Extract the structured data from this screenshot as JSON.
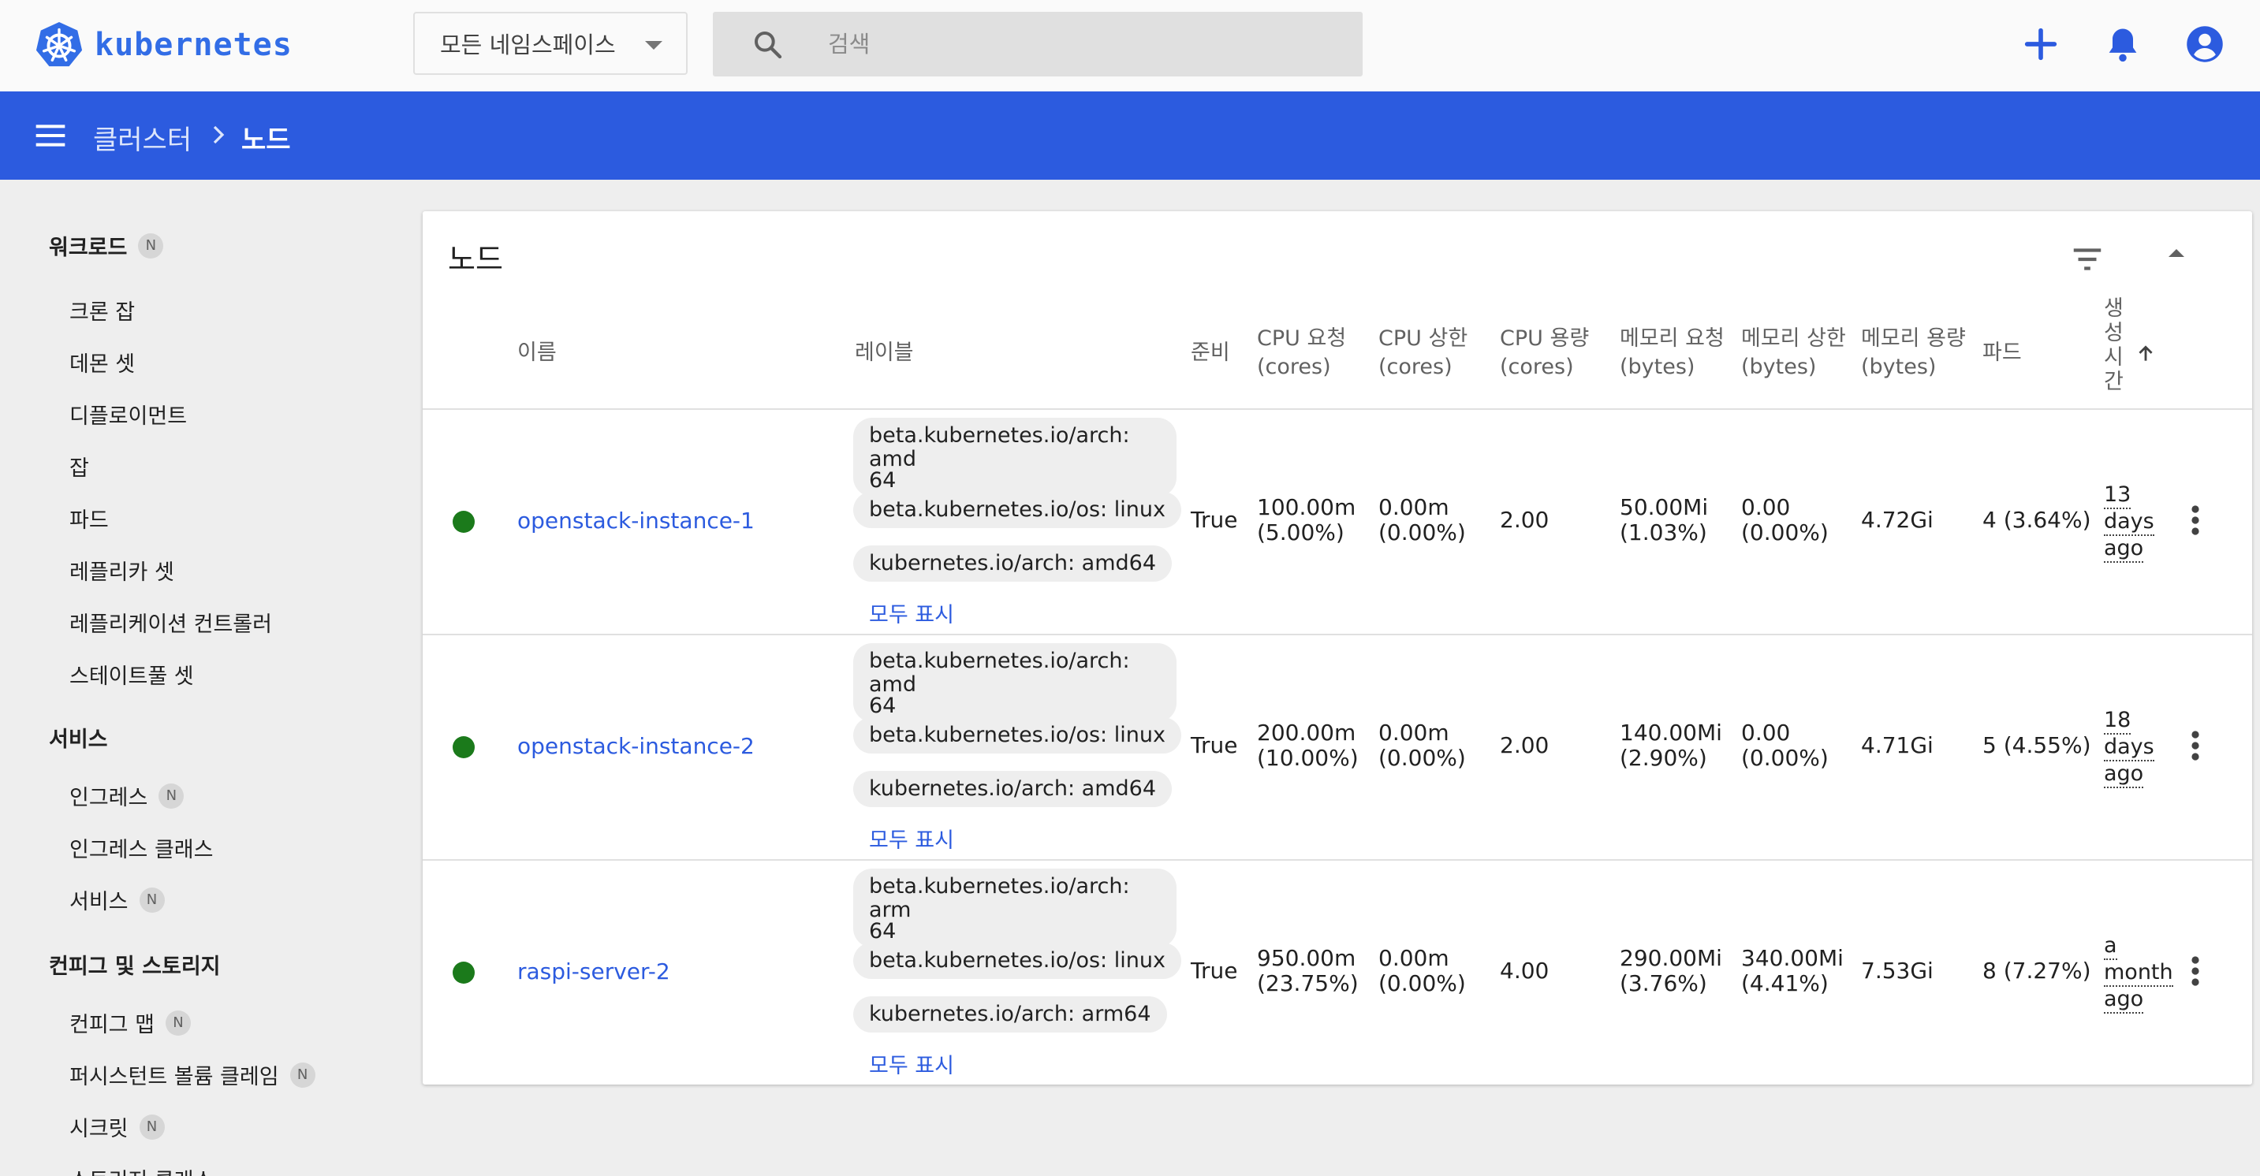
{
  "app": {
    "name": "kubernetes",
    "brand_color": "#326de6",
    "accent_color": "#2c5bdf"
  },
  "topbar": {
    "namespace_selected": "모든 네임스페이스",
    "search_placeholder": "검색",
    "icons": [
      "plus-icon",
      "bell-icon",
      "account-icon"
    ]
  },
  "breadcrumb": {
    "parent": "클러스터",
    "current": "노드"
  },
  "sidebar": {
    "groups": [
      {
        "label": "워크로드",
        "badge": "N",
        "items": [
          {
            "label": "크론 잡"
          },
          {
            "label": "데몬 셋"
          },
          {
            "label": "디플로이먼트"
          },
          {
            "label": "잡"
          },
          {
            "label": "파드"
          },
          {
            "label": "레플리카 셋"
          },
          {
            "label": "레플리케이션 컨트롤러"
          },
          {
            "label": "스테이트풀 셋"
          }
        ]
      },
      {
        "label": "서비스",
        "badge": "",
        "items": [
          {
            "label": "인그레스",
            "badge": "N"
          },
          {
            "label": "인그레스 클래스"
          },
          {
            "label": "서비스",
            "badge": "N"
          }
        ]
      },
      {
        "label": "컨피그 및 스토리지",
        "badge": "",
        "items": [
          {
            "label": "컨피그 맵",
            "badge": "N"
          },
          {
            "label": "퍼시스턴트 볼륨 클레임",
            "badge": "N"
          },
          {
            "label": "시크릿",
            "badge": "N"
          },
          {
            "label": "스토리지 클래스"
          }
        ]
      }
    ]
  },
  "card": {
    "title": "노드",
    "columns": {
      "name": "이름",
      "labels": "레이블",
      "ready": "준비",
      "cpu_req": [
        "CPU 요청",
        "(cores)"
      ],
      "cpu_lim": [
        "CPU 상한",
        "(cores)"
      ],
      "cpu_cap": [
        "CPU 용량",
        "(cores)"
      ],
      "mem_req": [
        "메모리 요청",
        "(bytes)"
      ],
      "mem_lim": [
        "메모리 상한",
        "(bytes)"
      ],
      "mem_cap": [
        "메모리 용량",
        "(bytes)"
      ],
      "pods": "파드",
      "created": [
        "생",
        "성",
        "시",
        "간"
      ]
    },
    "show_all": "모두 표시",
    "status_color": "#1b7a1b",
    "rows": [
      {
        "name": "openstack-instance-1",
        "labels": [
          "beta.kubernetes.io/arch: amd64",
          "beta.kubernetes.io/os: linux",
          "kubernetes.io/arch: amd64"
        ],
        "label0_lines": [
          "beta.kubernetes.io/arch: amd",
          "64"
        ],
        "ready": "True",
        "cpu_req": [
          "100.00m",
          "(5.00%)"
        ],
        "cpu_lim": [
          "0.00m",
          "(0.00%)"
        ],
        "cpu_cap": "2.00",
        "mem_req": [
          "50.00Mi",
          "(1.03%)"
        ],
        "mem_lim": [
          "0.00",
          "(0.00%)"
        ],
        "mem_cap": "4.72Gi",
        "pods": "4 (3.64%)",
        "age": [
          "13",
          "days",
          "ago"
        ]
      },
      {
        "name": "openstack-instance-2",
        "labels": [
          "beta.kubernetes.io/arch: amd64",
          "beta.kubernetes.io/os: linux",
          "kubernetes.io/arch: amd64"
        ],
        "label0_lines": [
          "beta.kubernetes.io/arch: amd",
          "64"
        ],
        "ready": "True",
        "cpu_req": [
          "200.00m",
          "(10.00%)"
        ],
        "cpu_lim": [
          "0.00m",
          "(0.00%)"
        ],
        "cpu_cap": "2.00",
        "mem_req": [
          "140.00Mi",
          "(2.90%)"
        ],
        "mem_lim": [
          "0.00",
          "(0.00%)"
        ],
        "mem_cap": "4.71Gi",
        "pods": "5 (4.55%)",
        "age": [
          "18",
          "days",
          "ago"
        ]
      },
      {
        "name": "raspi-server-2",
        "labels": [
          "beta.kubernetes.io/arch: arm64",
          "beta.kubernetes.io/os: linux",
          "kubernetes.io/arch: arm64"
        ],
        "label0_lines": [
          "beta.kubernetes.io/arch: arm",
          "64"
        ],
        "ready": "True",
        "cpu_req": [
          "950.00m",
          "(23.75%)"
        ],
        "cpu_lim": [
          "0.00m",
          "(0.00%)"
        ],
        "cpu_cap": "4.00",
        "mem_req": [
          "290.00Mi",
          "(3.76%)"
        ],
        "mem_lim": [
          "340.00Mi",
          "(4.41%)"
        ],
        "mem_cap": "7.53Gi",
        "pods": "8 (7.27%)",
        "age": [
          "a",
          "month",
          "ago"
        ]
      }
    ]
  }
}
